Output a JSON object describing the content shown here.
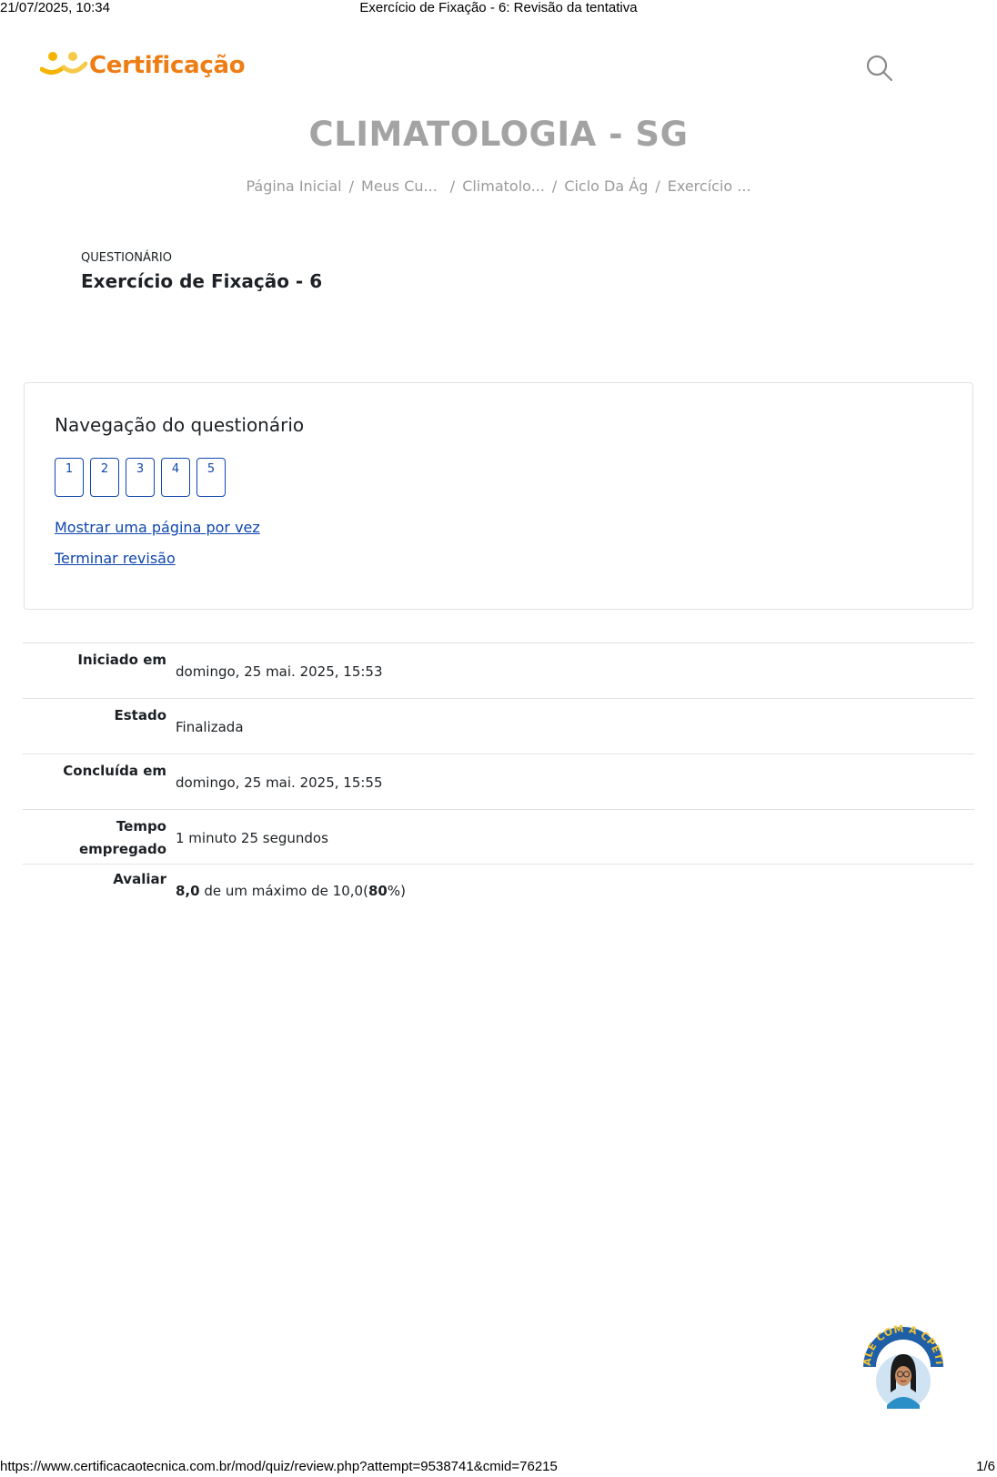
{
  "print": {
    "datetime": "21/07/2025, 10:34",
    "doc_title": "Exercício de Fixação - 6: Revisão da tentativa",
    "url": "https://www.certificacaotecnica.com.br/mod/quiz/review.php?attempt=9538741&cmid=76215",
    "page": "1/6"
  },
  "brand": {
    "name": "Certificação",
    "color": "#ee7d14"
  },
  "search": {
    "icon": "search-icon"
  },
  "course": {
    "title": "CLIMATOLOGIA - SG"
  },
  "breadcrumb": [
    "Página Inicial",
    "Meus Cu...",
    "Climatolo...",
    "Ciclo Da Ág",
    "Exercício ..."
  ],
  "quiz": {
    "pretitle": "QUESTIONÁRIO",
    "title": "Exercício de Fixação - 6"
  },
  "navigation": {
    "title": "Navegação do questionário",
    "questions": [
      "1",
      "2",
      "3",
      "4",
      "5"
    ],
    "show_one_page": "Mostrar uma página por vez",
    "finish_review": "Terminar revisão"
  },
  "summary": {
    "started_label": "Iniciado em",
    "started_value": "domingo, 25 mai. 2025, 15:53",
    "state_label": "Estado",
    "state_value": "Finalizada",
    "completed_label": "Concluída em",
    "completed_value": "domingo, 25 mai. 2025, 15:55",
    "time_label_1": "Tempo",
    "time_label_2": "empregado",
    "time_value": "1 minuto 25 segundos",
    "grade_label": "Avaliar",
    "grade_score": "8,0",
    "grade_middle": " de um máximo de 10,0(",
    "grade_percent": "80",
    "grade_end": "%)"
  },
  "chat": {
    "badge_text": "FALE COM A CPETia"
  },
  "colors": {
    "link": "#0f47ad",
    "muted": "#a3a3a3",
    "border": "#dee2e6"
  }
}
